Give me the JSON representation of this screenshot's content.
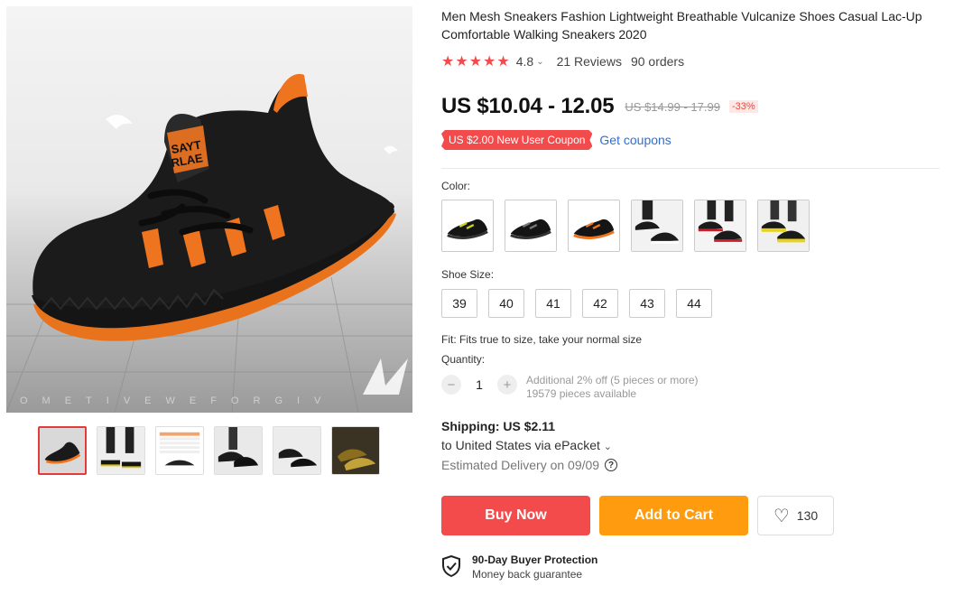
{
  "product": {
    "title": "Men Mesh Sneakers Fashion Lightweight Breathable Vulcanize Shoes Casual Lac-Up Comfortable Walking Sneakers 2020",
    "stars": "★★★★★",
    "rating": "4.8",
    "reviews": "21 Reviews",
    "orders": "90 orders",
    "price": "US $10.04 - 12.05",
    "old_price": "US $14.99 - 17.99",
    "discount": "-33%",
    "coupon": "US $2.00 New User Coupon",
    "get_coupons": "Get coupons"
  },
  "gallery": {
    "watermark": "OMETIVEWEFORGIV",
    "thumbnails": [
      "black-orange",
      "pair-worn",
      "size-chart",
      "black-worn",
      "black-pair",
      "yellow-pair"
    ],
    "active_index": 0
  },
  "options": {
    "color_label": "Color:",
    "colors": [
      "black-yellow",
      "black-gray",
      "black-orange",
      "black-white-worn",
      "red-worn",
      "yellow-worn"
    ],
    "size_label": "Shoe Size:",
    "sizes": [
      "39",
      "40",
      "41",
      "42",
      "43",
      "44"
    ],
    "fit": "Fit: Fits true to size, take your normal size"
  },
  "quantity": {
    "label": "Quantity:",
    "minus": "−",
    "value": "1",
    "plus": "+",
    "info_line1": "Additional 2% off (5 pieces or more)",
    "info_line2": "19579 pieces available"
  },
  "shipping": {
    "title": "Shipping: US $2.11",
    "to": "to United States via ePacket",
    "caret": "⌄",
    "delivery": "Estimated Delivery on 09/09",
    "help": "?"
  },
  "actions": {
    "buy": "Buy Now",
    "cart": "Add to Cart",
    "wishlist_count": "130"
  },
  "protection": {
    "title": "90-Day Buyer Protection",
    "subtitle": "Money back guarantee"
  },
  "colors": {
    "accent_red": "#f34b4b",
    "accent_orange": "#ff9b0f",
    "link_blue": "#2e6fd6"
  }
}
